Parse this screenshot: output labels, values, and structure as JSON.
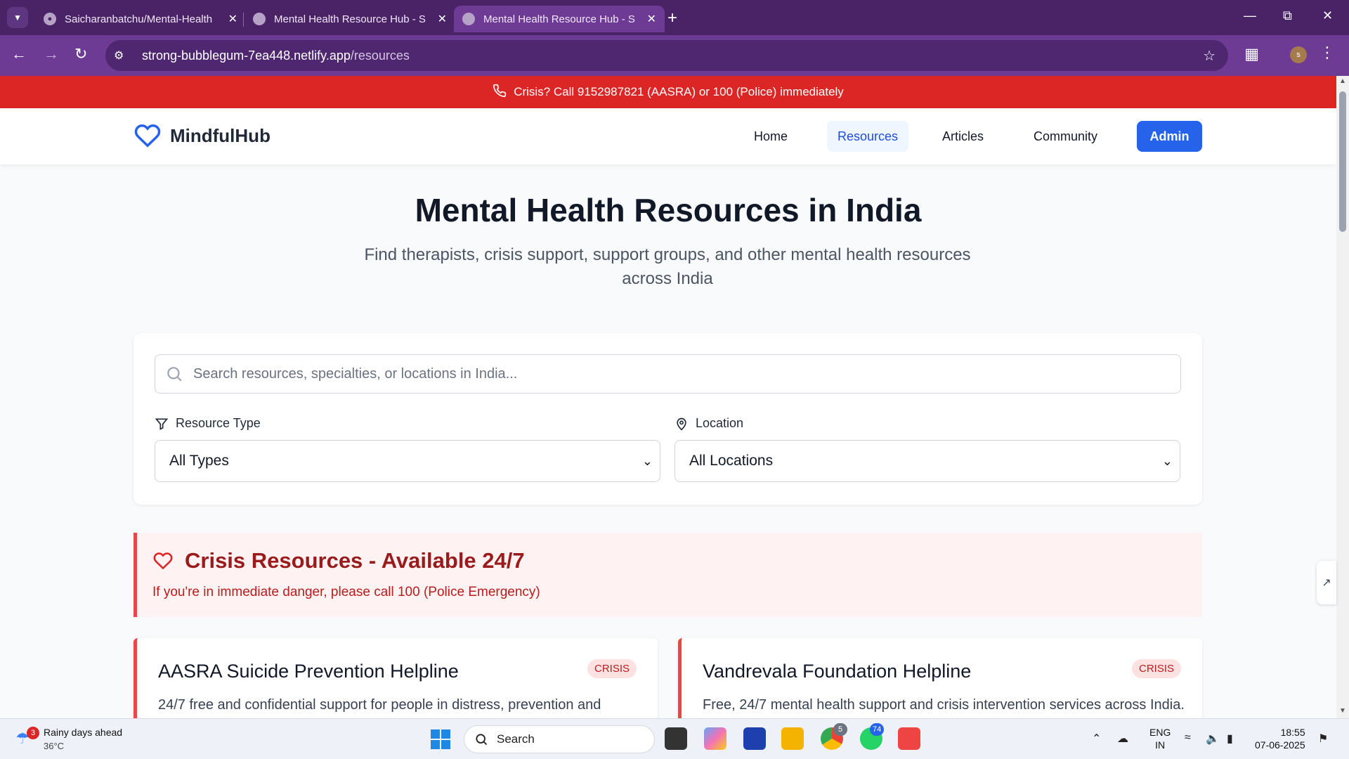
{
  "browser": {
    "tabs": [
      {
        "title": "Saicharanbatchu/Mental-Health",
        "active": false
      },
      {
        "title": "Mental Health Resource Hub - S",
        "active": false
      },
      {
        "title": "Mental Health Resource Hub - S",
        "active": true
      }
    ],
    "url_host": "strong-bubblegum-7ea448.netlify.app",
    "url_path": "/resources",
    "profile_initial": "s"
  },
  "banner": {
    "text": "Crisis? Call 9152987821 (AASRA) or 100 (Police) immediately"
  },
  "header": {
    "logo": "MindfulHub",
    "nav": [
      {
        "label": "Home",
        "active": false
      },
      {
        "label": "Resources",
        "active": true
      },
      {
        "label": "Articles",
        "active": false
      },
      {
        "label": "Community",
        "active": false
      }
    ],
    "admin_label": "Admin"
  },
  "hero": {
    "title": "Mental Health Resources in India",
    "subtitle": "Find therapists, crisis support, support groups, and other mental health resources across India"
  },
  "filters": {
    "search_placeholder": "Search resources, specialties, or locations in India...",
    "type_label": "Resource Type",
    "type_value": "All Types",
    "location_label": "Location",
    "location_value": "All Locations"
  },
  "crisis_section": {
    "title": "Crisis Resources - Available 24/7",
    "note": "If you're in immediate danger, please call 100 (Police Emergency)"
  },
  "resources": [
    {
      "name": "AASRA Suicide Prevention Helpline",
      "badge": "CRISIS",
      "desc": "24/7 free and confidential support for people in distress, prevention and"
    },
    {
      "name": "Vandrevala Foundation Helpline",
      "badge": "CRISIS",
      "desc": "Free, 24/7 mental health support and crisis intervention services across India."
    }
  ],
  "taskbar": {
    "weather_title": "Rainy days ahead",
    "weather_temp": "36°C",
    "weather_badge": "3",
    "search_label": "Search",
    "chrome_badge": "5",
    "whatsapp_badge": "74",
    "lang_top": "ENG",
    "lang_bottom": "IN",
    "time": "18:55",
    "date": "07-06-2025"
  },
  "colors": {
    "accent": "#2563eb",
    "crisis_red": "#dc2626",
    "browser_purple": "#6d3b94"
  }
}
